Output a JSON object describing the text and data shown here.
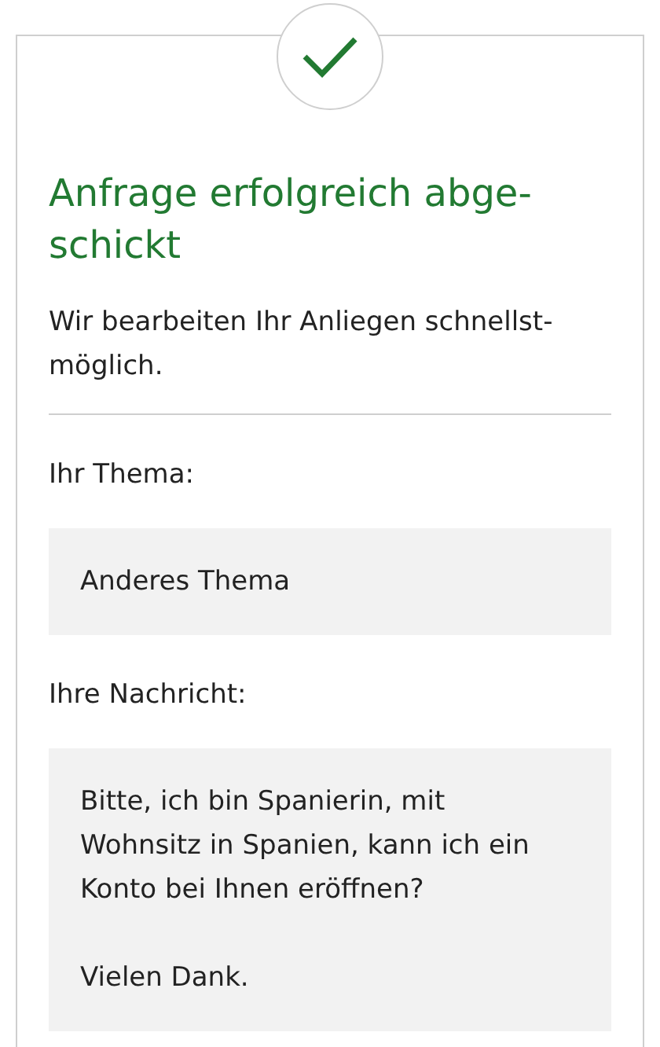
{
  "status": {
    "kind": "success"
  },
  "title": "Anfrage erfolgreich abge-\nschickt",
  "message": "Wir bearbeiten Ihr Anliegen schnellst-\nmöglich.",
  "fields": [
    {
      "label": "Ihr Thema:",
      "value": "Anderes Thema"
    },
    {
      "label": "Ihre Nachricht:",
      "value": "Bitte, ich bin Spanierin, mit\nWohnsitz in Spanien, kann ich ein\nKonto bei Ihnen eröffnen?\n\nVielen Dank."
    }
  ]
}
